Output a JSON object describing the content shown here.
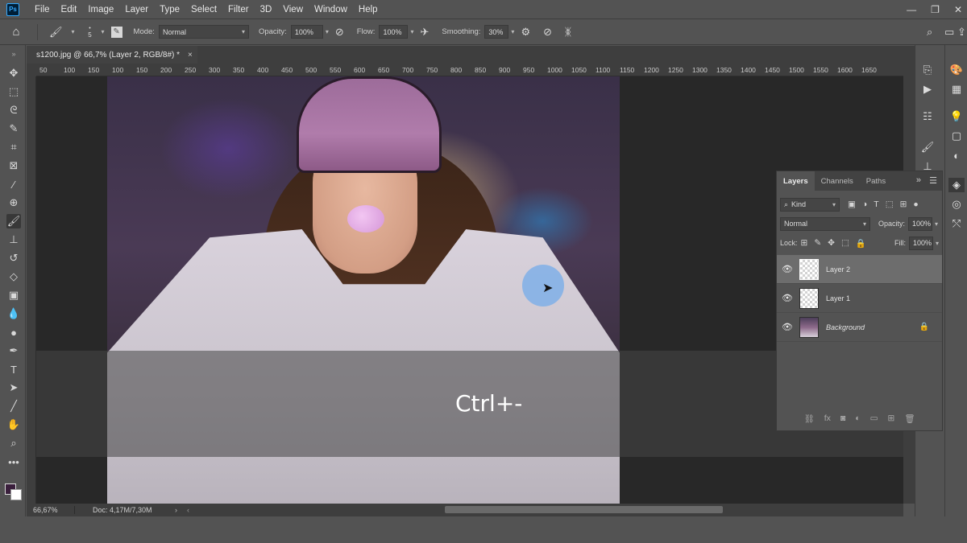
{
  "app": {
    "logo_text": "Ps"
  },
  "menu": [
    "File",
    "Edit",
    "Image",
    "Layer",
    "Type",
    "Select",
    "Filter",
    "3D",
    "View",
    "Window",
    "Help"
  ],
  "window_controls": [
    "—",
    "❐",
    "✕"
  ],
  "options_bar": {
    "brush_size": "5",
    "mode_label": "Mode:",
    "mode_value": "Normal",
    "opacity_label": "Opacity:",
    "opacity_value": "100%",
    "flow_label": "Flow:",
    "flow_value": "100%",
    "smoothing_label": "Smoothing:",
    "smoothing_value": "30%"
  },
  "document_tab": {
    "title": "s1200.jpg @ 66,7% (Layer 2, RGB/8#) *",
    "close": "×"
  },
  "ruler_ticks": [
    "50",
    "100",
    "150",
    "100",
    "150",
    "200",
    "250",
    "300",
    "350",
    "400",
    "450",
    "500",
    "550",
    "600",
    "650",
    "700",
    "750",
    "800",
    "850",
    "900",
    "950",
    "1000",
    "1050",
    "1100",
    "1150",
    "1200",
    "1250",
    "1300",
    "1350",
    "1400",
    "1450",
    "1500",
    "1550",
    "1600",
    "1650"
  ],
  "canvas": {
    "shortcut_text": "Ctrl+-"
  },
  "status": {
    "zoom": "66,67%",
    "doc": "Doc: 4,17M/7,30M"
  },
  "layers_panel": {
    "tabs": [
      "Layers",
      "Channels",
      "Paths"
    ],
    "filter_label": "Kind",
    "blend_mode": "Normal",
    "opacity_label": "Opacity:",
    "opacity_value": "100%",
    "lock_label": "Lock:",
    "fill_label": "Fill:",
    "fill_value": "100%",
    "layers": [
      {
        "name": "Layer 2",
        "selected": true
      },
      {
        "name": "Layer 1",
        "selected": false
      },
      {
        "name": "Background",
        "selected": false,
        "locked": true
      }
    ]
  },
  "colors": {
    "ui_bg": "#535353",
    "panel_dark": "#424242",
    "selected_layer": "#6d6d6d",
    "canvas_bg": "#282828",
    "accent_blue": "#31a8ff"
  },
  "icons": {
    "home": "home-icon",
    "brush": "brush-icon",
    "settings": "gear-icon",
    "search": "search-icon"
  }
}
